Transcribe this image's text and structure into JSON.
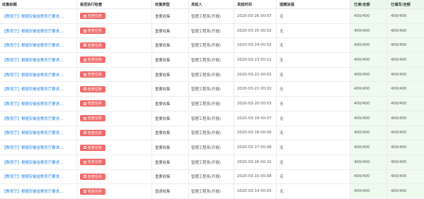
{
  "table": {
    "headers": {
      "title": "收集标题",
      "exec": "是否执行检查",
      "type": "收集类型",
      "initiator": "发起人",
      "time": "发起时间",
      "remind": "提醒加强",
      "read": "已读/全部",
      "done": "已填写/全部"
    },
    "button_label": "检查任务",
    "rows": [
      {
        "title": "【教育厅】根据安徽省教育厅要求,…",
        "type": "重要收集",
        "initiator": "管理工程系(开报)",
        "time": "2020-03-26 00:07",
        "remind": "无",
        "read": "400/400",
        "done": "400/400"
      },
      {
        "title": "【教育厅】根据安徽省教育厅要求,…",
        "type": "重要收集",
        "initiator": "管理工程系(开报)",
        "time": "2020-03-25 00:02",
        "remind": "无",
        "read": "400/400",
        "done": "400/400"
      },
      {
        "title": "【教育厅】根据安徽省教育厅要求,…",
        "type": "重要收集",
        "initiator": "管理工程系(开报)",
        "time": "2020-03-24 00:02",
        "remind": "无",
        "read": "400/400",
        "done": "400/400"
      },
      {
        "title": "【教育厅】根据安徽省教育厅要求,…",
        "type": "重要收集",
        "initiator": "管理工程系(开报)",
        "time": "2020-03-23 00:12",
        "remind": "无",
        "read": "400/400",
        "done": "400/400"
      },
      {
        "title": "【教育厅】根据安徽省教育厅要求,…",
        "type": "重要收集",
        "initiator": "管理工程系(开报)",
        "time": "2020-03-22 00:01",
        "remind": "无",
        "read": "400/400",
        "done": "400/400"
      },
      {
        "title": "【教育厅】根据安徽省教育厅要求,…",
        "type": "重要收集",
        "initiator": "管理工程系(开报)",
        "time": "2020-03-21 00:02",
        "remind": "无",
        "read": "400/400",
        "done": "400/400"
      },
      {
        "title": "【教育厅】根据安徽省教育厅要求,…",
        "type": "重要收集",
        "initiator": "管理工程系(开报)",
        "time": "2020-03-20 00:03",
        "remind": "无",
        "read": "400/400",
        "done": "400/400"
      },
      {
        "title": "【教育厅】根据安徽省教育厅要求,…",
        "type": "重要收集",
        "initiator": "管理工程系(开报)",
        "time": "2020-03-19 00:07",
        "remind": "无",
        "read": "400/400",
        "done": "400/400"
      },
      {
        "title": "【教育厅】根据安徽省教育厅要求,…",
        "type": "重要收集",
        "initiator": "管理工程系(开报)",
        "time": "2020-03-18 00:00",
        "remind": "无",
        "read": "400/400",
        "done": "400/400"
      },
      {
        "title": "【教育厅】根据安徽省教育厅要求,…",
        "type": "重要收集",
        "initiator": "管理工程系(开报)",
        "time": "2020-03-17 00:06",
        "remind": "无",
        "read": "400/400",
        "done": "400/400"
      },
      {
        "title": "【教育厅】根据安徽省教育厅要求,…",
        "type": "重要收集",
        "initiator": "管理工程系(开报)",
        "time": "2020-03-16 00:32",
        "remind": "无",
        "read": "400/400",
        "done": "400/400"
      },
      {
        "title": "【教育厅】根据安徽省教育厅要求,…",
        "type": "重要收集",
        "initiator": "管理工程系(开报)",
        "time": "2020-03-15 00:08",
        "remind": "无",
        "read": "400/400",
        "done": "400/400"
      },
      {
        "title": "【教育厅】根据安徽省教育厅要求,…",
        "type": "普通收集",
        "initiator": "管理工程系(开报)",
        "time": "2020-03-14 00:05",
        "remind": "无",
        "read": "400/400",
        "done": "400/400"
      }
    ],
    "colors": {
      "link": "#2b86e0",
      "button": "#f06b6b",
      "highlight_column": "#eefaee"
    }
  }
}
